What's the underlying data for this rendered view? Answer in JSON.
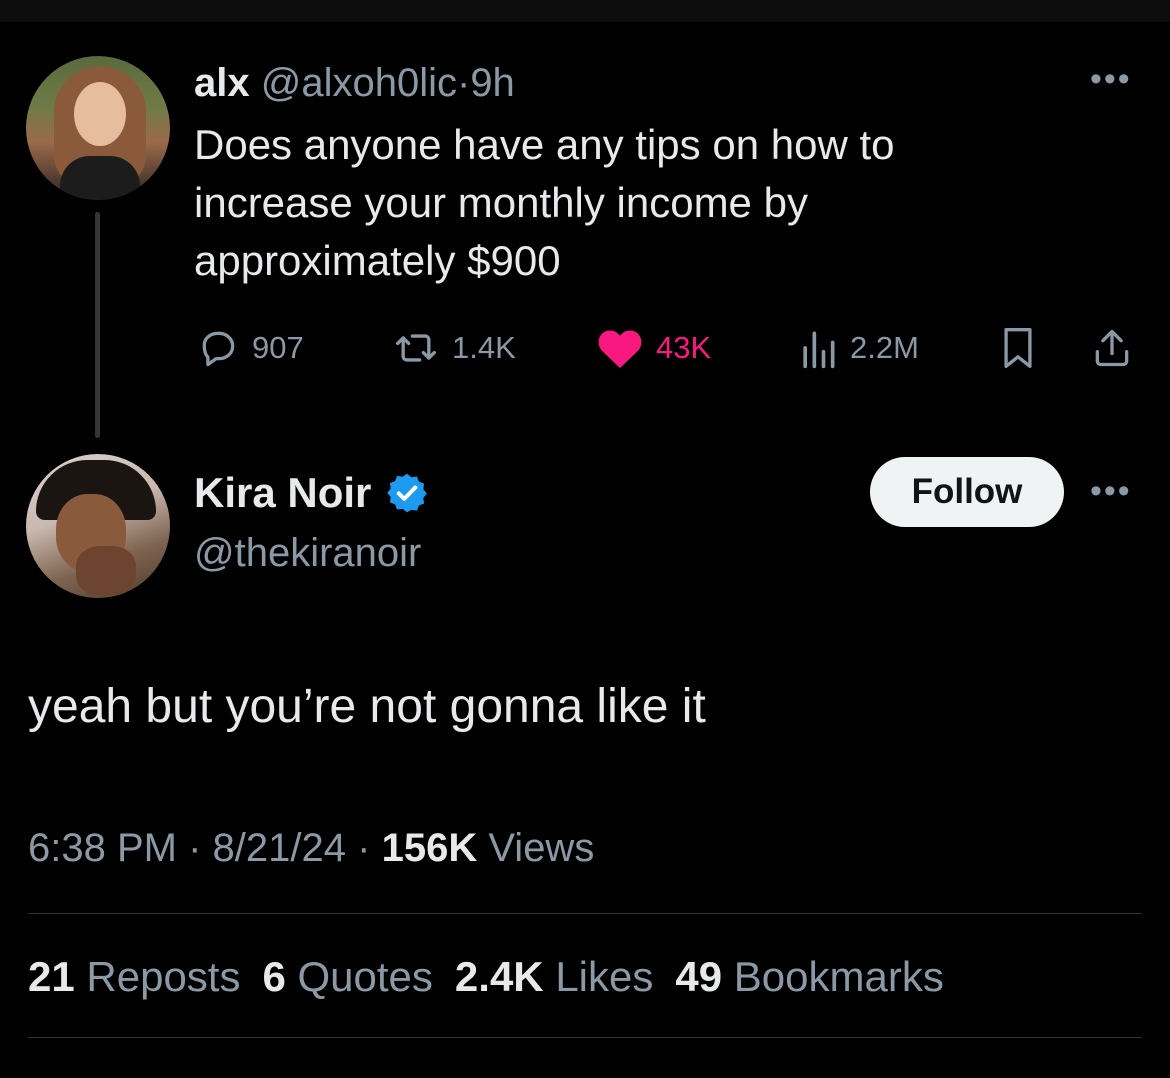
{
  "parent_tweet": {
    "display_name": "alx",
    "handle": "@alxoh0lic",
    "separator": "·",
    "time_ago": "9h",
    "text": "Does anyone have any tips on how to increase your monthly income by approximately $900",
    "replies": "907",
    "reposts": "1.4K",
    "likes": "43K",
    "views": "2.2M",
    "like_color": "#f91880"
  },
  "main_tweet": {
    "display_name": "Kira Noir",
    "handle": "@thekiranoir",
    "verified_icon": "verified-badge-icon",
    "verified_color": "#1d9bf0",
    "follow_label": "Follow",
    "text": "yeah but you’re not gonna like it",
    "time": "6:38 PM",
    "separator": "·",
    "date": "8/21/24",
    "views_count": "156K",
    "views_label": "Views"
  },
  "stats": {
    "reposts_count": "21",
    "reposts_label": "Reposts",
    "quotes_count": "6",
    "quotes_label": "Quotes",
    "likes_count": "2.4K",
    "likes_label": "Likes",
    "bookmarks_count": "49",
    "bookmarks_label": "Bookmarks"
  },
  "icons": {
    "more": "more-options-icon",
    "reply": "reply-icon",
    "repost": "repost-icon",
    "like": "heart-icon",
    "views": "views-chart-icon",
    "bookmark": "bookmark-icon",
    "share": "share-icon"
  }
}
